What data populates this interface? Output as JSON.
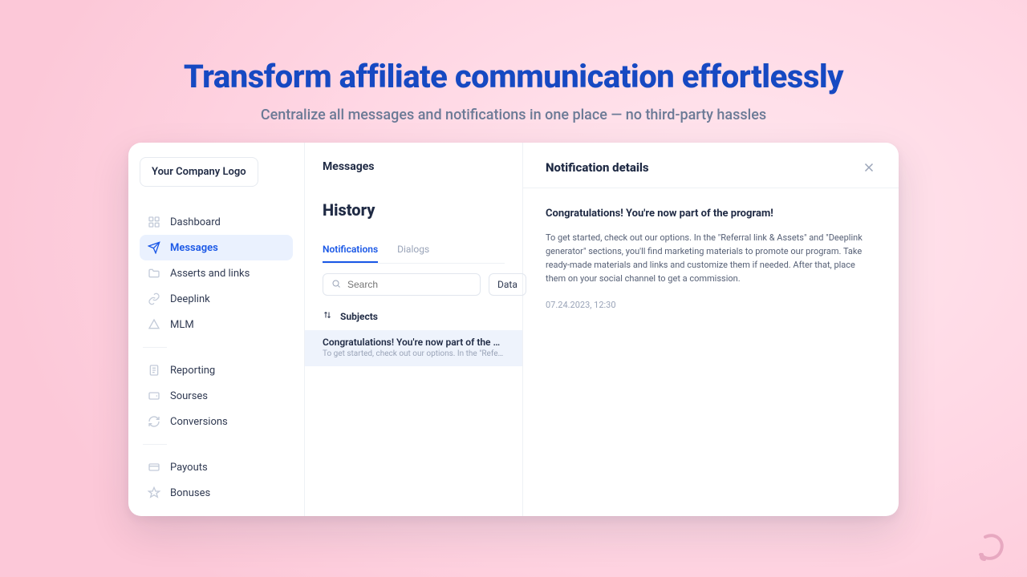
{
  "hero": {
    "title": "Transform affiliate communication effortlessly",
    "subtitle": "Centralize all messages and notifications in one place — no third-party hassles"
  },
  "sidebar": {
    "logo_label": "Your Company Logo",
    "groups": [
      [
        "Dashboard",
        "Messages",
        "Asserts and links",
        "Deeplink",
        "MLM"
      ],
      [
        "Reporting",
        "Sourses",
        "Conversions"
      ],
      [
        "Payouts",
        "Bonuses"
      ]
    ],
    "active_index": 1
  },
  "center": {
    "heading": "Messages",
    "subheading": "History",
    "tabs": {
      "items": [
        "Notifications",
        "Dialogs"
      ],
      "active": 0
    },
    "search": {
      "placeholder": "Search",
      "value": ""
    },
    "data_chip": "Data",
    "column_header": "Subjects",
    "rows": [
      {
        "title": "Congratulations! You're now part of the program!",
        "preview": "To get started, check out our options. In the \"Referral link & Assets\" ..."
      }
    ]
  },
  "detail": {
    "panel_title": "Notification details",
    "subject": "Congratulations! You're now part of the program!",
    "body": "To get started, check out our options. In the \"Referral link & Assets\" and \"Deeplink generator\" sections, you'll find marketing materials to promote our program. Take ready-made materials and links and customize them if needed. After that, place them on your social channel to get a commission.",
    "timestamp": "07.24.2023, 12:30"
  }
}
